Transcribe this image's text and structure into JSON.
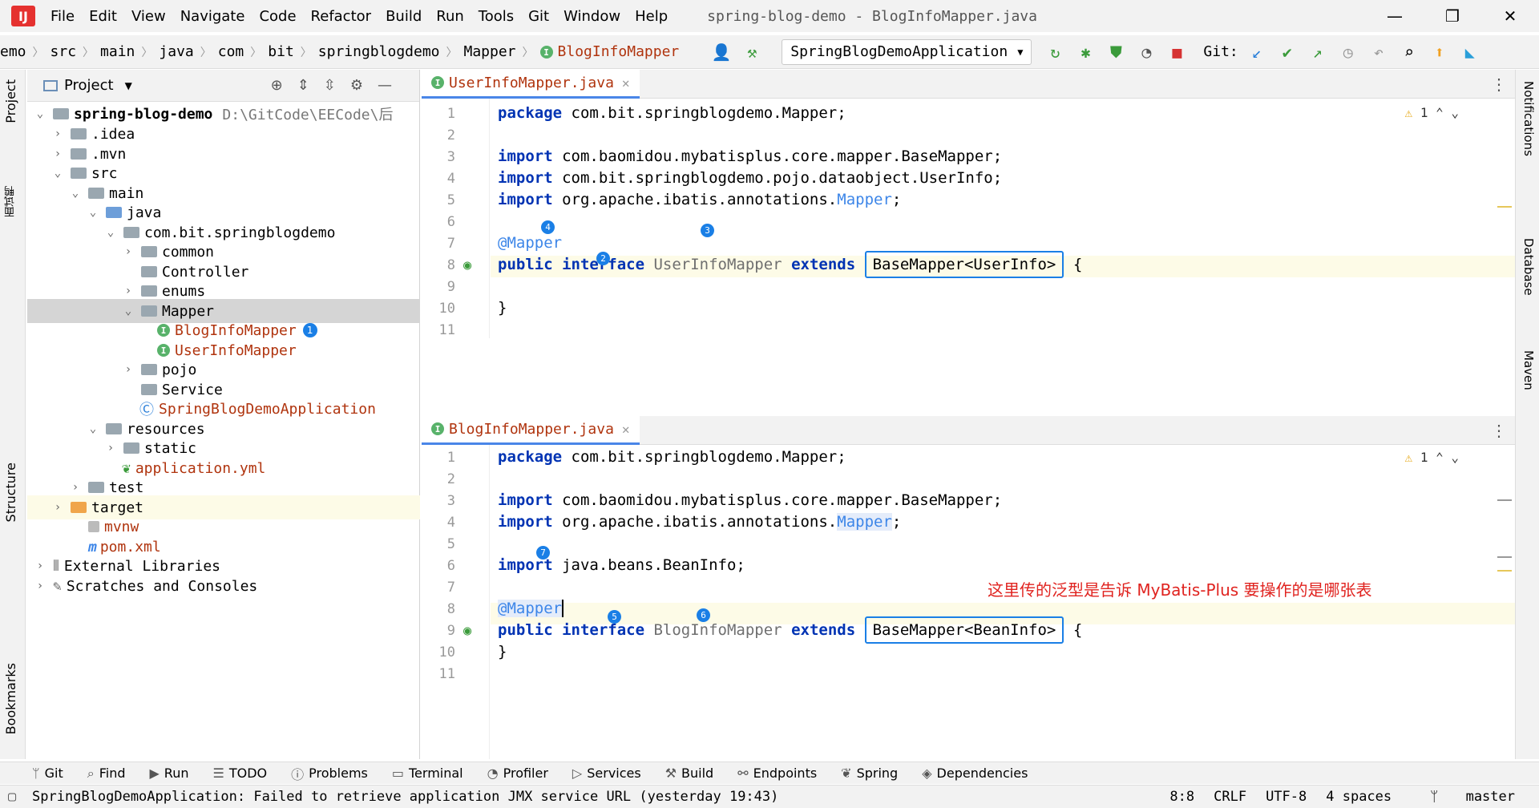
{
  "menubar": {
    "logo": "IJ",
    "items": [
      "File",
      "Edit",
      "View",
      "Navigate",
      "Code",
      "Refactor",
      "Build",
      "Run",
      "Tools",
      "Git",
      "Window",
      "Help"
    ],
    "window_title": "spring-blog-demo - BlogInfoMapper.java"
  },
  "navbar": {
    "breadcrumbs": [
      "emo",
      "src",
      "main",
      "java",
      "com",
      "bit",
      "springblogdemo",
      "Mapper"
    ],
    "active_file": "BlogInfoMapper",
    "run_config": "SpringBlogDemoApplication",
    "git_label": "Git:"
  },
  "left_strip": {
    "project": "Project",
    "extra": "面试鸭",
    "structure": "Structure",
    "bookmarks": "Bookmarks"
  },
  "right_strip": {
    "notifications": "Notifications",
    "database": "Database",
    "maven": "Maven"
  },
  "project_panel": {
    "title": "Project",
    "tree": [
      {
        "label": "spring-blog-demo",
        "path": "D:\\GitCode\\EECode\\后"
      },
      {
        "label": ".idea"
      },
      {
        "label": ".mvn"
      },
      {
        "label": "src"
      },
      {
        "label": "main"
      },
      {
        "label": "java"
      },
      {
        "label": "com.bit.springblogdemo"
      },
      {
        "label": "common"
      },
      {
        "label": "Controller"
      },
      {
        "label": "enums"
      },
      {
        "label": "Mapper"
      },
      {
        "label": "BlogInfoMapper",
        "badge": "1"
      },
      {
        "label": "UserInfoMapper"
      },
      {
        "label": "pojo"
      },
      {
        "label": "Service"
      },
      {
        "label": "SpringBlogDemoApplication"
      },
      {
        "label": "resources"
      },
      {
        "label": "static"
      },
      {
        "label": "application.yml"
      },
      {
        "label": "test"
      },
      {
        "label": "target"
      },
      {
        "label": "mvnw"
      },
      {
        "label": "pom.xml"
      },
      {
        "label": "External Libraries"
      },
      {
        "label": "Scratches and Consoles"
      }
    ]
  },
  "editor_top": {
    "tab": "UserInfoMapper.java",
    "warning": "1",
    "lines": {
      "l1_kw": "package",
      "l1_rest": " com.bit.springblogdemo.Mapper;",
      "l3_kw": "import",
      "l3_rest": " com.baomidou.mybatisplus.core.mapper.BaseMapper;",
      "l4_kw": "import",
      "l4_rest": " com.bit.springblogdemo.pojo.dataobject.UserInfo;",
      "l5_kw": "import",
      "l5_rest": " org.apache.ibatis.annotations.",
      "l5_ann": "Mapper",
      "l5_end": ";",
      "l7_ann": "@Mapper",
      "l8_kw1": "public interface",
      "l8_name": " UserInfoMapper ",
      "l8_kw2": "extends",
      "l8_box": "BaseMapper<UserInfo>",
      "l8_end": " {",
      "l10": "}"
    },
    "badges": [
      "4",
      "3",
      "2"
    ]
  },
  "editor_bottom": {
    "tab": "BlogInfoMapper.java",
    "warning": "1",
    "lines": {
      "l1_kw": "package",
      "l1_rest": " com.bit.springblogdemo.Mapper;",
      "l3_kw": "import",
      "l3_rest": " com.baomidou.mybatisplus.core.mapper.BaseMapper;",
      "l4_kw": "import",
      "l4_rest": " org.apache.ibatis.annotations.",
      "l4_ann": "Mapper",
      "l4_end": ";",
      "l6_kw": "import",
      "l6_rest": " java.beans.BeanInfo;",
      "l8_ann": "@Mapper",
      "l9_kw1": "public interface",
      "l9_name": " BlogInfoMapper ",
      "l9_kw2": "extends",
      "l9_box": "BaseMapper<BeanInfo>",
      "l9_end": " {",
      "l10": "}"
    },
    "badges": [
      "7",
      "5",
      "6"
    ],
    "note": "这里传的泛型是告诉 MyBatis-Plus 要操作的是哪张表"
  },
  "toolwindows": [
    "Git",
    "Find",
    "Run",
    "TODO",
    "Problems",
    "Terminal",
    "Profiler",
    "Services",
    "Build",
    "Endpoints",
    "Spring",
    "Dependencies"
  ],
  "status": {
    "message": "SpringBlogDemoApplication: Failed to retrieve application JMX service URL (yesterday 19:43)",
    "position": "8:8",
    "line_sep": "CRLF",
    "encoding": "UTF-8",
    "indent": "4 spaces",
    "branch": "master"
  },
  "colors": {
    "accent": "#1a7fe6",
    "annotation": "#3d86e8",
    "keyword": "#0033b3",
    "note": "#e0231f",
    "file_red": "#b0340e"
  }
}
